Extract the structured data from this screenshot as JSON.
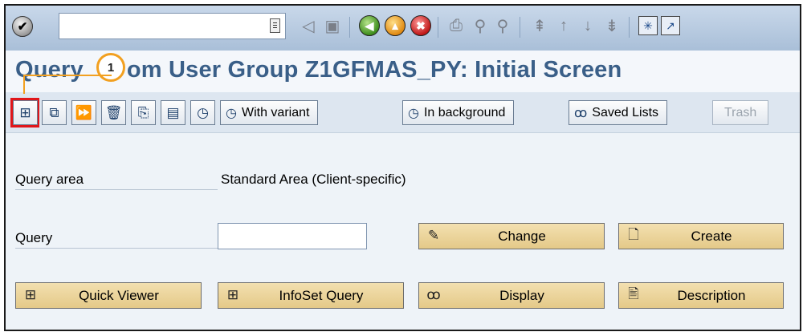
{
  "title": "Query from User Group Z1GFMAS_PY: Initial Screen",
  "title_visible_prefix": "Query",
  "title_visible_suffix": "om User Group Z1GFMAS_PY: Initial Screen",
  "step_marker": "1",
  "toolbar": {
    "with_variant": "With variant",
    "in_background": "In background",
    "saved_lists": "Saved Lists",
    "trash": "Trash"
  },
  "form": {
    "query_area_label": "Query area",
    "query_area_value": "Standard Area (Client-specific)",
    "query_label": "Query",
    "query_value": ""
  },
  "buttons": {
    "change": "Change",
    "create": "Create",
    "quick_viewer": "Quick Viewer",
    "infoset_query": "InfoSet Query",
    "display": "Display",
    "description": "Description"
  }
}
